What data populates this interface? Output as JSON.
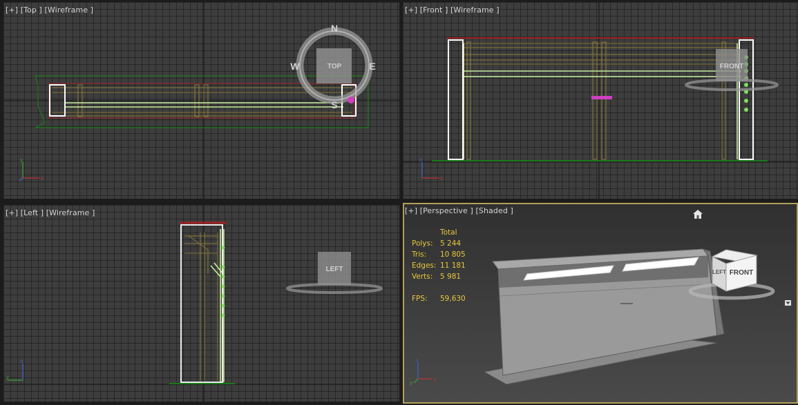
{
  "viewports": {
    "top": {
      "label": "[+] [Top ] [Wireframe ]",
      "viewcube": {
        "face": "TOP",
        "compass": {
          "n": "N",
          "s": "S",
          "e": "E",
          "w": "W"
        }
      }
    },
    "front": {
      "label": "[+] [Front ] [Wireframe ]",
      "viewcube": {
        "face": "FRONT"
      }
    },
    "left": {
      "label": "[+] [Left ] [Wireframe ]",
      "viewcube": {
        "face": "LEFT"
      }
    },
    "perspective": {
      "label": "[+] [Perspective ] [Shaded ]",
      "viewcube": {
        "left_face": "LEFT",
        "front_face": "FRONT"
      },
      "stats": {
        "header": "Total",
        "rows": [
          {
            "key": "Polys:",
            "value": "5 244"
          },
          {
            "key": "Tris:",
            "value": "10 805"
          },
          {
            "key": "Edges:",
            "value": "11 181"
          },
          {
            "key": "Verts:",
            "value": "5 981"
          }
        ],
        "fps_key": "FPS:",
        "fps_value": "59,630"
      }
    }
  },
  "axis_labels": {
    "x": "x",
    "y": "y",
    "z": "z"
  },
  "colors": {
    "viewport_bg": "#3d3d3d",
    "active_border": "#b3a15a",
    "stats_text": "#e7c83c",
    "wire_green": "#c8f0a0",
    "wire_olive": "#8c7a3c",
    "wire_red": "#b02020",
    "wire_darkgreen": "#1a7a1a"
  },
  "icons": [
    "home-icon",
    "dropdown-arrow-icon"
  ]
}
